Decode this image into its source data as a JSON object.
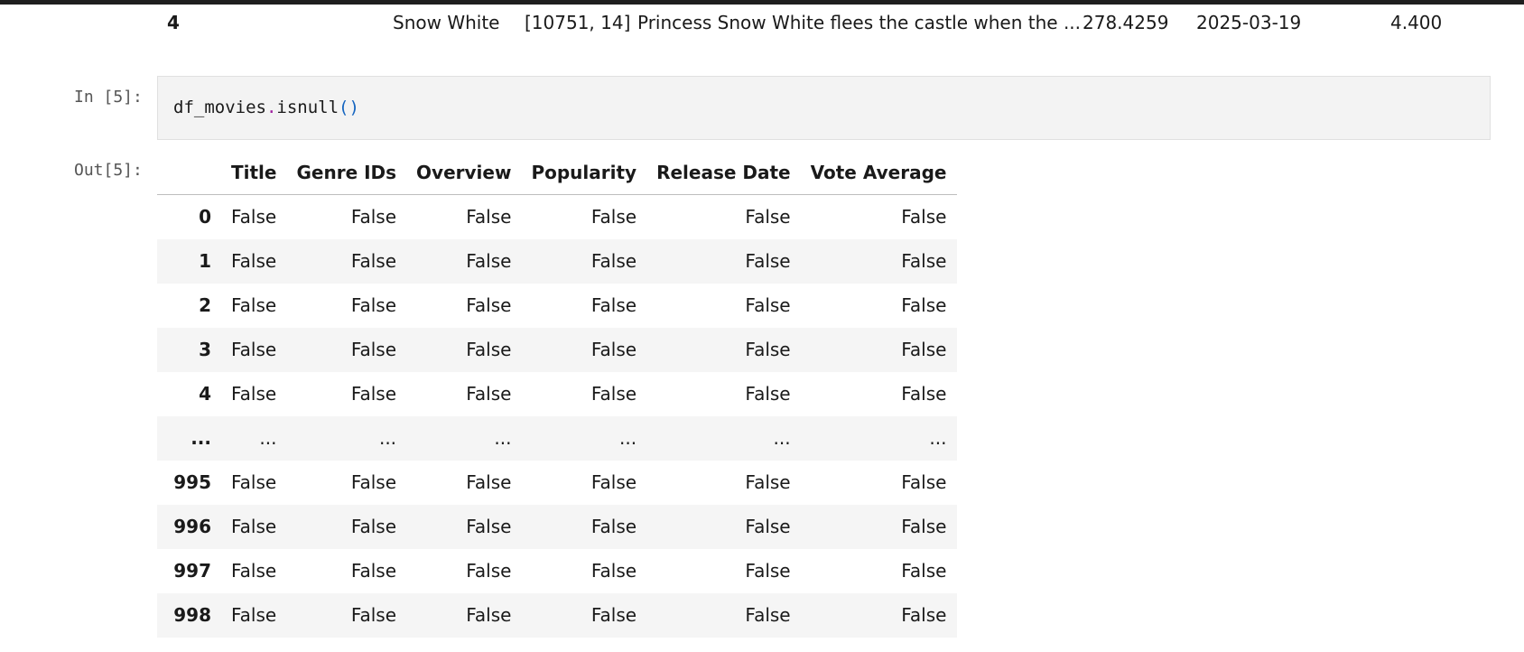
{
  "previous_output_row": {
    "index": "4",
    "title": "Snow White",
    "genre_ids": "[10751, 14]",
    "overview": "Princess Snow White flees the castle when the ...",
    "popularity": "278.4259",
    "release_date": "2025-03-19",
    "vote_average": "4.400"
  },
  "cell": {
    "in_prompt": "In [5]:",
    "out_prompt": "Out[5]:",
    "code": {
      "object": "df_movies",
      "dot": ".",
      "method": "isnull",
      "parens": "()"
    }
  },
  "dataframe": {
    "index_header": "",
    "columns": [
      "Title",
      "Genre IDs",
      "Overview",
      "Popularity",
      "Release Date",
      "Vote Average"
    ],
    "rows": [
      {
        "index": "0",
        "values": [
          "False",
          "False",
          "False",
          "False",
          "False",
          "False"
        ]
      },
      {
        "index": "1",
        "values": [
          "False",
          "False",
          "False",
          "False",
          "False",
          "False"
        ]
      },
      {
        "index": "2",
        "values": [
          "False",
          "False",
          "False",
          "False",
          "False",
          "False"
        ]
      },
      {
        "index": "3",
        "values": [
          "False",
          "False",
          "False",
          "False",
          "False",
          "False"
        ]
      },
      {
        "index": "4",
        "values": [
          "False",
          "False",
          "False",
          "False",
          "False",
          "False"
        ]
      },
      {
        "index": "...",
        "values": [
          "...",
          "...",
          "...",
          "...",
          "...",
          "..."
        ]
      },
      {
        "index": "995",
        "values": [
          "False",
          "False",
          "False",
          "False",
          "False",
          "False"
        ]
      },
      {
        "index": "996",
        "values": [
          "False",
          "False",
          "False",
          "False",
          "False",
          "False"
        ]
      },
      {
        "index": "997",
        "values": [
          "False",
          "False",
          "False",
          "False",
          "False",
          "False"
        ]
      },
      {
        "index": "998",
        "values": [
          "False",
          "False",
          "False",
          "False",
          "False",
          "False"
        ]
      }
    ]
  }
}
